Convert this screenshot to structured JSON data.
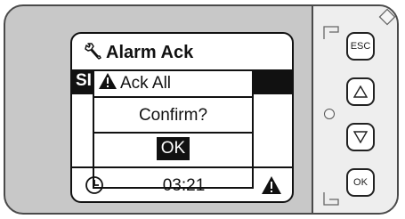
{
  "screen": {
    "title": "Alarm Ack",
    "header_label": "SI",
    "dialog": {
      "title": "Ack All",
      "message": "Confirm?",
      "ok_label": "OK"
    },
    "status": {
      "time": "03:21"
    }
  },
  "keypad": {
    "esc_label": "ESC",
    "ok_label": "OK",
    "up_icon": "triangle-up-icon",
    "down_icon": "triangle-down-icon"
  },
  "colors": {
    "bezel": "#c8c8c8",
    "panel": "#eeeeee",
    "display_bg": "#ffffff",
    "display_fg": "#111111"
  }
}
